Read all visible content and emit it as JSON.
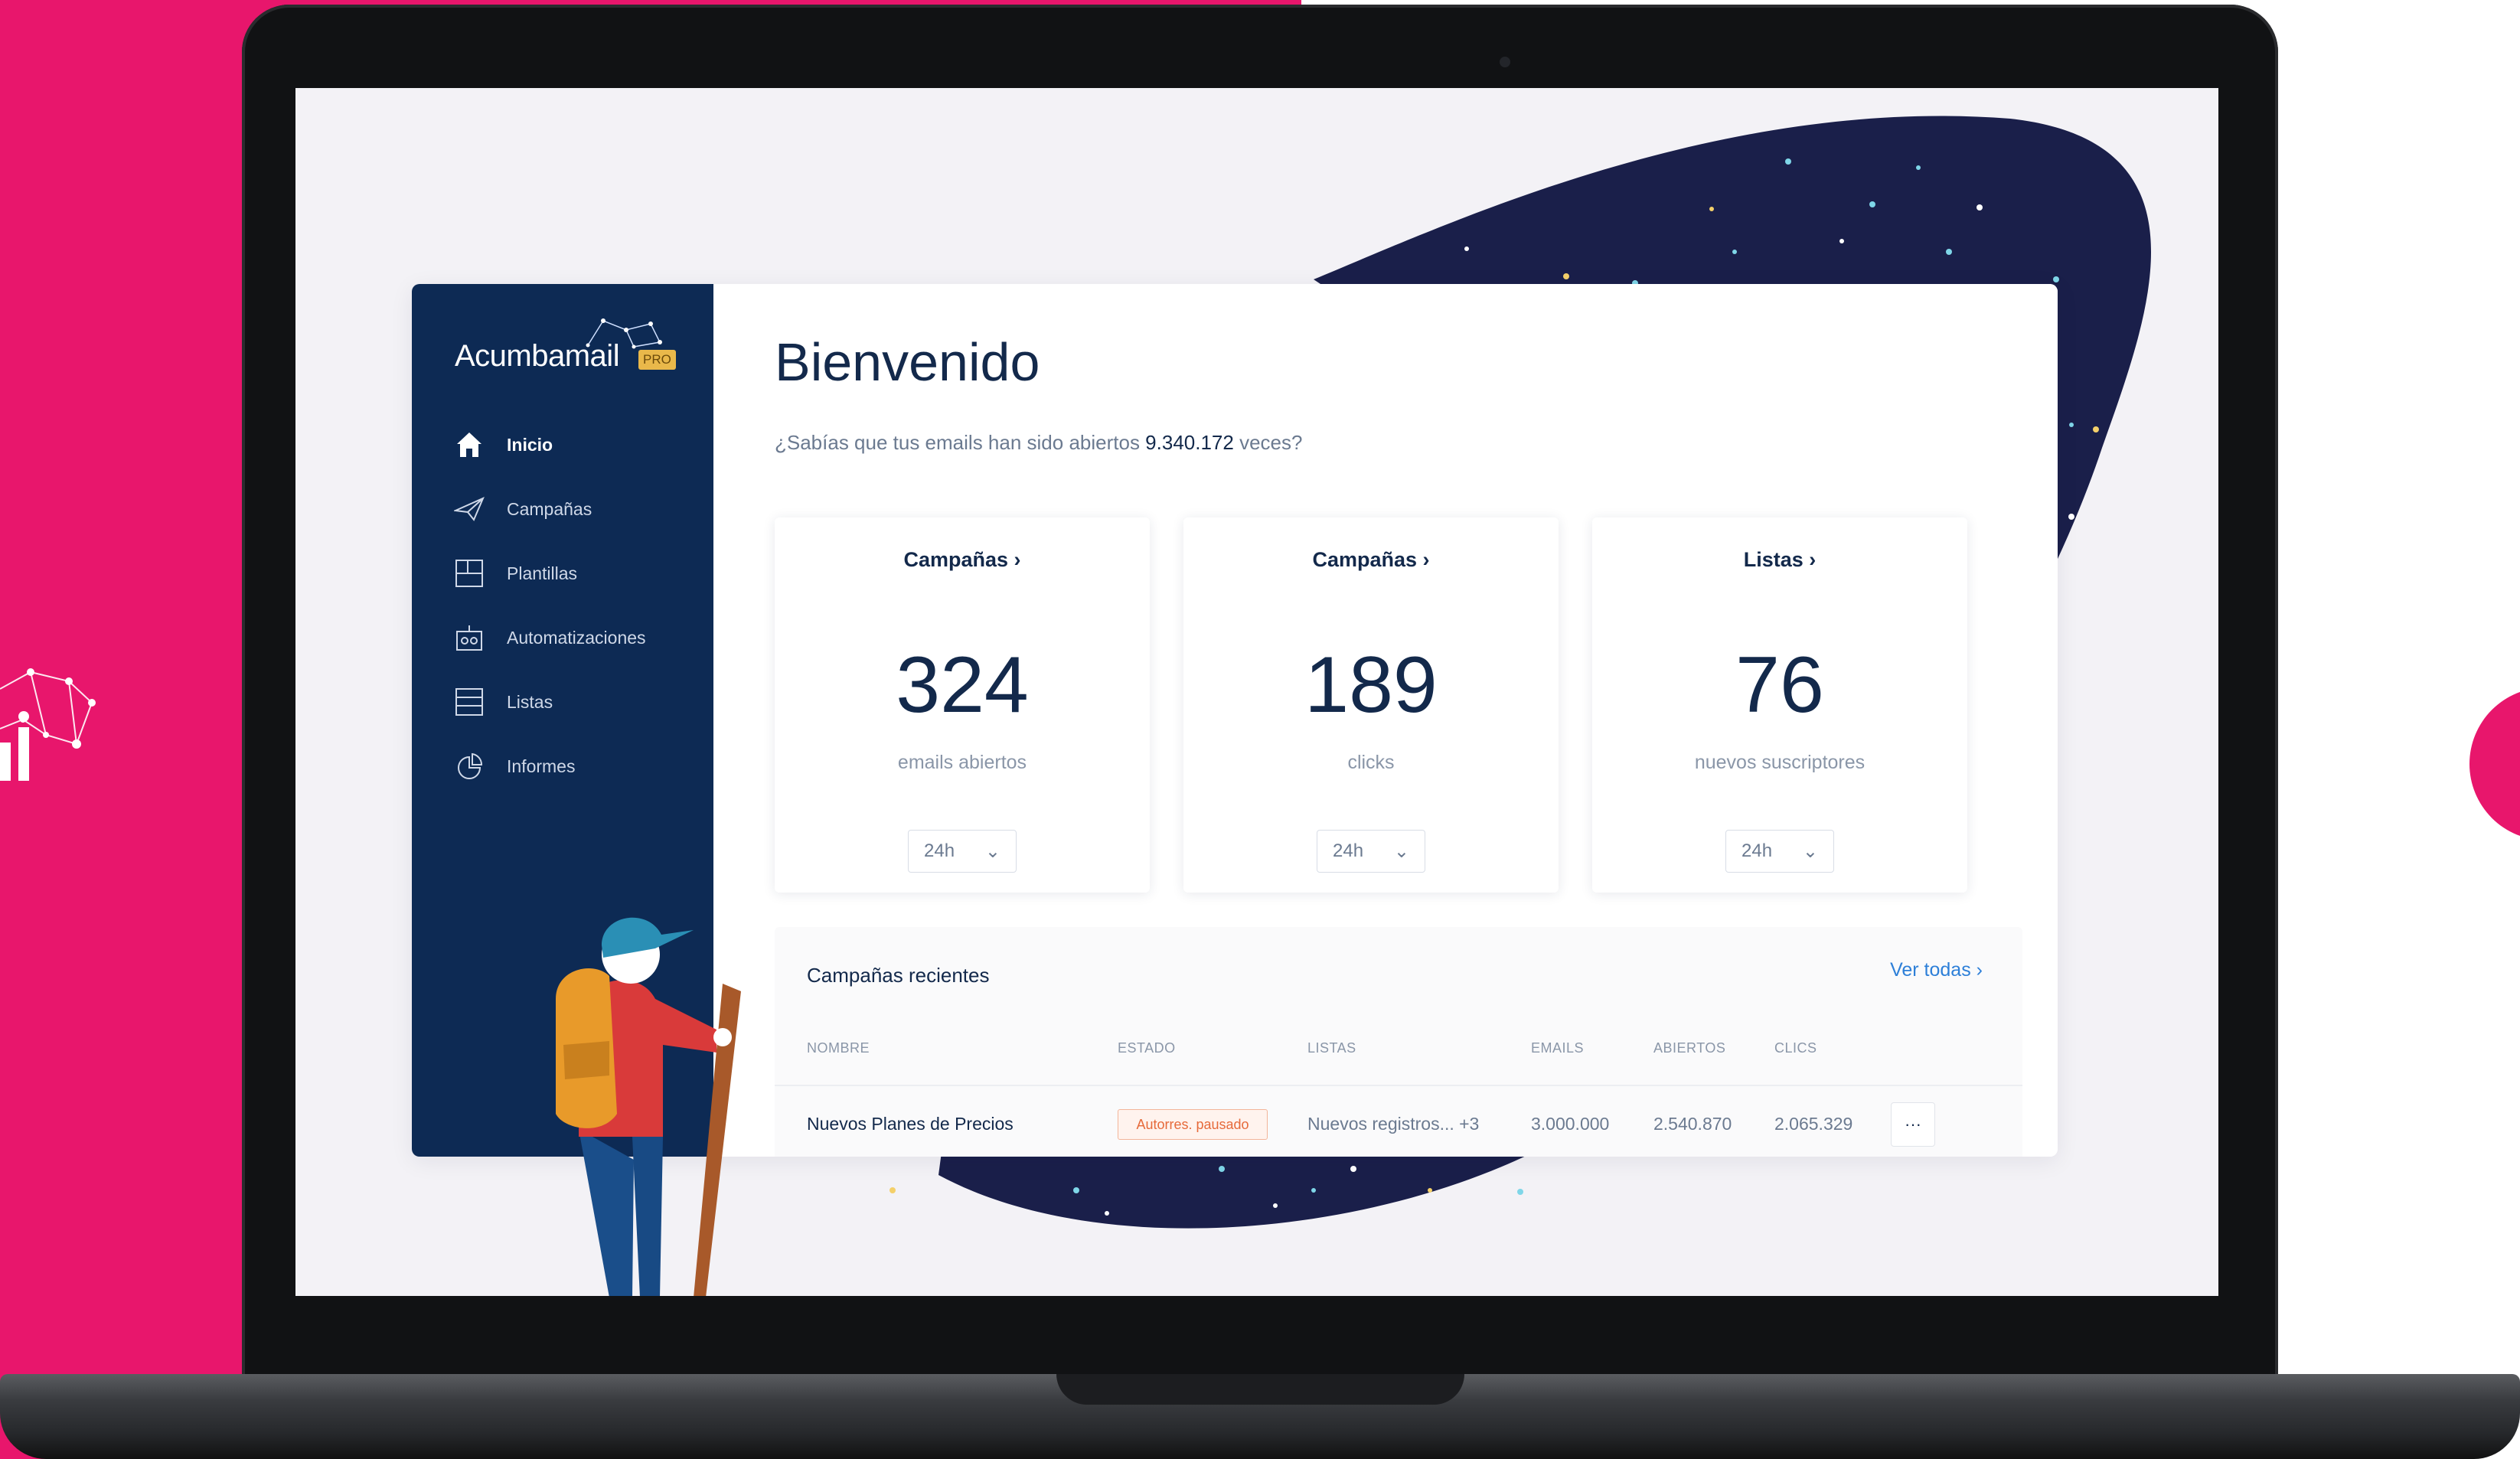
{
  "brand": {
    "name": "Acumbamail",
    "badge": "PRO"
  },
  "nav": [
    {
      "label": "Inicio",
      "icon": "home-icon",
      "active": true
    },
    {
      "label": "Campañas",
      "icon": "paper-plane-icon"
    },
    {
      "label": "Plantillas",
      "icon": "template-icon"
    },
    {
      "label": "Automatizaciones",
      "icon": "robot-icon"
    },
    {
      "label": "Listas",
      "icon": "list-icon"
    },
    {
      "label": "Informes",
      "icon": "report-icon"
    }
  ],
  "header": {
    "title": "Bienvenido",
    "subtitle_pre": "¿Sabías que tus emails han sido abiertos ",
    "subtitle_value": "9.340.172",
    "subtitle_post": " veces?"
  },
  "stats": [
    {
      "heading": "Campañas",
      "value": "324",
      "label": "emails abiertos",
      "period": "24h"
    },
    {
      "heading": "Campañas",
      "value": "189",
      "label": "clicks",
      "period": "24h"
    },
    {
      "heading": "Listas",
      "value": "76",
      "label": "nuevos suscriptores",
      "period": "24h"
    }
  ],
  "recent": {
    "title": "Campañas recientes",
    "link": "Ver todas",
    "columns": [
      "NOMBRE",
      "ESTADO",
      "LISTAS",
      "EMAILS",
      "ABIERTOS",
      "CLICS"
    ],
    "rows": [
      {
        "name": "Nuevos Planes de Precios",
        "status": "Autorres. pausado",
        "lists": "Nuevos registros... +3",
        "emails": "3.000.000",
        "opened": "2.540.870",
        "clicks": "2.065.329",
        "actions": "···"
      }
    ]
  },
  "colors": {
    "pink": "#e8166c",
    "navy": "#0d2a54",
    "night": "#1a1f4a",
    "link": "#2d7fd8",
    "badge": "#e66a3a"
  }
}
